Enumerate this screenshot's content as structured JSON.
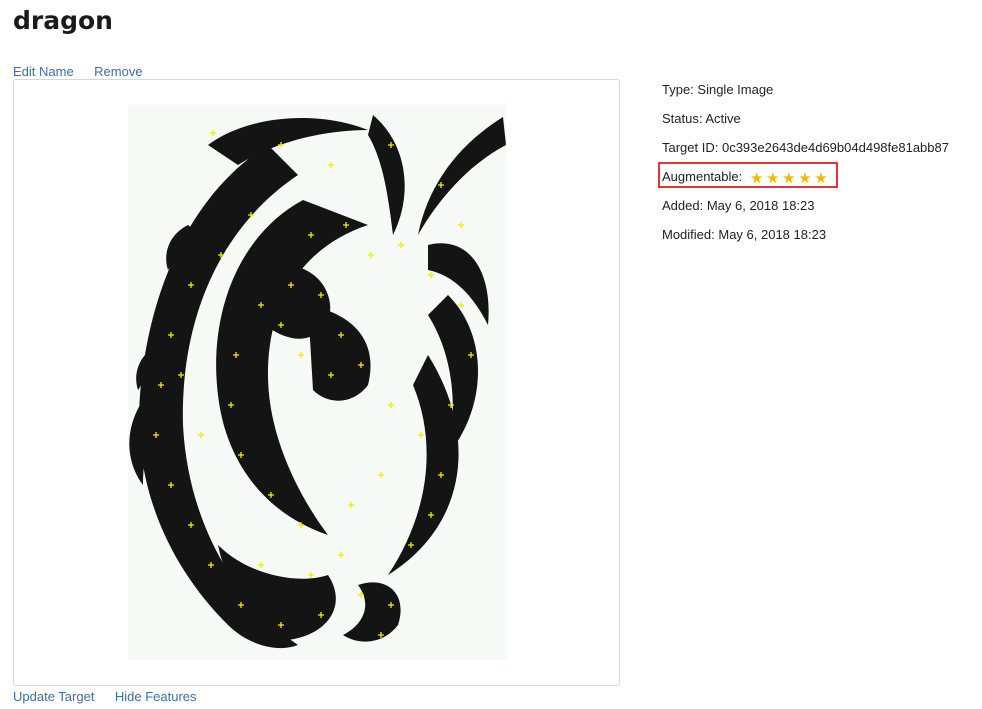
{
  "page": {
    "title": "dragon"
  },
  "actions": {
    "edit_name": "Edit Name",
    "remove": "Remove"
  },
  "bottom_actions": {
    "update_target": "Update Target",
    "hide_features": "Hide Features"
  },
  "target_info": {
    "type": "Type: Single Image",
    "status": "Status: Active",
    "target_id": "Target ID: 0c393e2643de4d69b04d498fe81abb87",
    "augmentable_label": "Augmentable:",
    "augmentable_rating": 5,
    "augmentable_max": 5,
    "added": "Added: May 6, 2018 18:23",
    "modified": "Modified: May 6, 2018 18:23"
  },
  "colors": {
    "link": "#3b6fa8",
    "highlight_border": "#e0363a",
    "star": "#f5b800",
    "feature_marker": "#f2ee00",
    "dragon": "#141414"
  },
  "icons": {
    "star": "star-icon",
    "feature": "plus-marker"
  }
}
